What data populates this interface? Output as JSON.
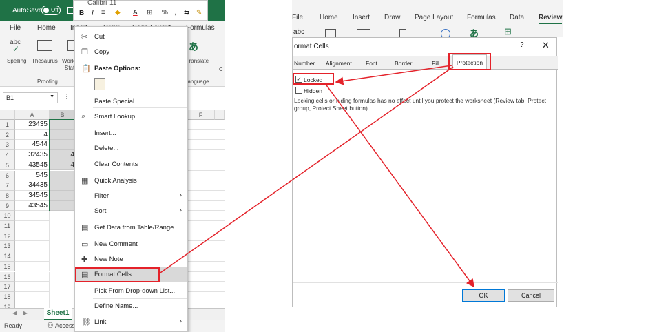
{
  "left_excel": {
    "autosave_label": "AutoSave",
    "autosave_state": "Off",
    "minitoolbar": {
      "font": "Calibri",
      "size": "11",
      "bold": "B",
      "italic": "I",
      "font_color_letter": "A"
    },
    "menu_tabs": [
      "File",
      "Home",
      "Insert",
      "Draw",
      "Page Layout",
      "Formulas"
    ],
    "ribbon": {
      "spelling_icon_text": "abc",
      "spelling": "Spelling",
      "thesaurus": "Thesaurus",
      "workbook_stats_top": "Work",
      "workbook_stats_bottom": "Stati",
      "translate": "Translate",
      "proofing": "Proofing",
      "language": "Language",
      "comments_letter": "C"
    },
    "name_box": "B1",
    "columns": [
      "A",
      "B",
      "F"
    ],
    "rows": [
      "1",
      "2",
      "3",
      "4",
      "5",
      "6",
      "7",
      "8",
      "9",
      "10",
      "11",
      "12",
      "13",
      "14",
      "15",
      "16",
      "17",
      "18",
      "19"
    ],
    "col_a_values": [
      "23435",
      "4",
      "4544",
      "32435",
      "43545",
      "545",
      "34435",
      "34545",
      "43545"
    ],
    "col_b_visible": {
      "row4": "4",
      "row5": "4"
    },
    "sheet_tab": "Sheet1",
    "status": "Ready",
    "accessibility": "Accessi"
  },
  "context_menu": {
    "items": [
      {
        "label": "Cut",
        "icon": "scissors-icon"
      },
      {
        "label": "Copy",
        "icon": "copy-icon"
      },
      {
        "label": "Paste Options:",
        "icon": "paste-icon"
      },
      {
        "label": "Paste Special...",
        "icon": ""
      },
      {
        "label": "Smart Lookup",
        "icon": "search-icon"
      },
      {
        "label": "Insert...",
        "icon": ""
      },
      {
        "label": "Delete...",
        "icon": ""
      },
      {
        "label": "Clear Contents",
        "icon": ""
      },
      {
        "label": "Quick Analysis",
        "icon": "quick-analysis-icon"
      },
      {
        "label": "Filter",
        "icon": ""
      },
      {
        "label": "Sort",
        "icon": ""
      },
      {
        "label": "Get Data from Table/Range...",
        "icon": "table-icon"
      },
      {
        "label": "New Comment",
        "icon": "comment-icon"
      },
      {
        "label": "New Note",
        "icon": "note-icon"
      },
      {
        "label": "Format Cells...",
        "icon": "format-cells-icon"
      },
      {
        "label": "Pick From Drop-down List...",
        "icon": ""
      },
      {
        "label": "Define Name...",
        "icon": ""
      },
      {
        "label": "Link",
        "icon": "link-icon"
      }
    ]
  },
  "right_excel": {
    "menu_tabs": [
      "File",
      "Home",
      "Insert",
      "Draw",
      "Page Layout",
      "Formulas",
      "Data",
      "Review"
    ],
    "ribbon_abc": "abc",
    "dialog": {
      "title": "ormat Cells",
      "help": "?",
      "close": "✕",
      "tabs": [
        "Number",
        "Alignment",
        "Font",
        "Border",
        "Fill",
        "Protection"
      ],
      "locked_label": "Locked",
      "hidden_label": "Hidden",
      "info_text": "Locking cells or hiding formulas has no effect until you protect the worksheet (Review tab, Protect group, Protect Sheet button).",
      "ok": "OK",
      "cancel": "Cancel"
    }
  },
  "colors": {
    "excel_green": "#1f7246",
    "annotation_red": "#e4222a",
    "selection_gray": "#d9d9d9"
  }
}
